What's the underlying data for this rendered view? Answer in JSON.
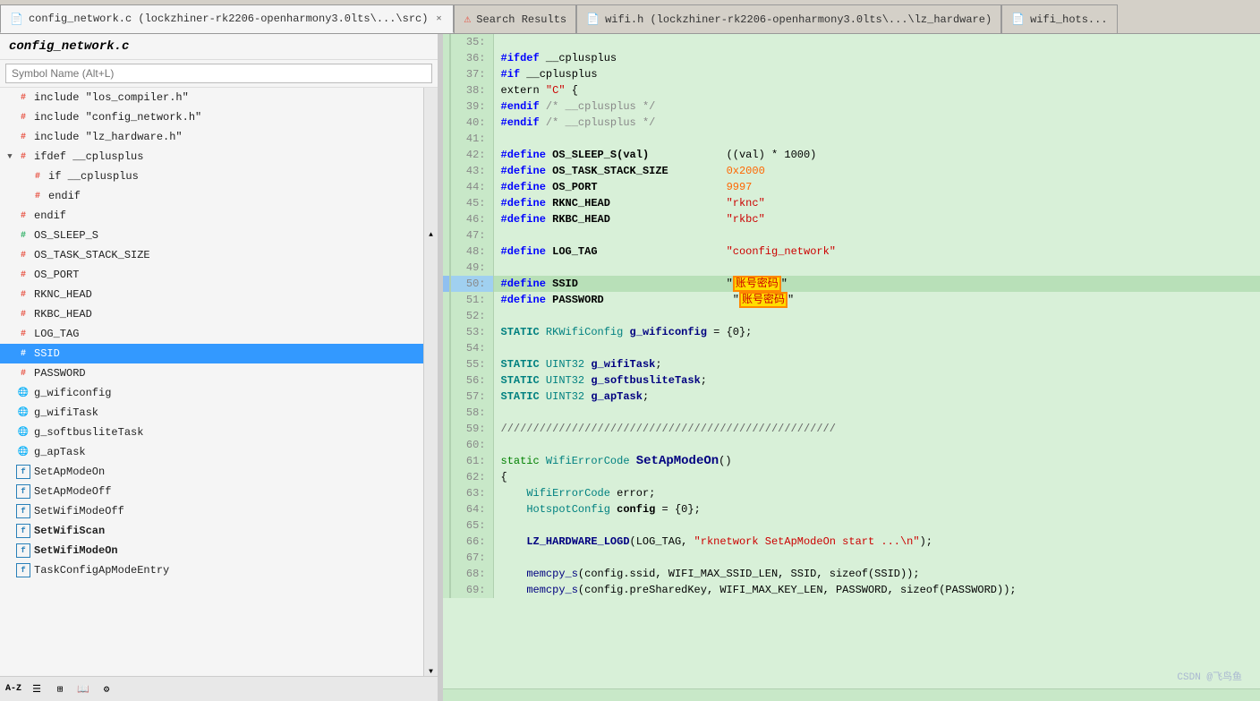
{
  "tabs": [
    {
      "id": "tab1",
      "label": "config_network.c (lockzhiner-rk2206-openharmony3.0lts\\...\\src)",
      "active": true,
      "closable": true,
      "icon": "file"
    },
    {
      "id": "tab2",
      "label": "Search Results",
      "active": false,
      "closable": false,
      "icon": "error"
    },
    {
      "id": "tab3",
      "label": "wifi.h (lockzhiner-rk2206-openharmony3.0lts\\...\\lz_hardware)",
      "active": false,
      "closable": false,
      "icon": "file"
    },
    {
      "id": "tab4",
      "label": "wifi_hots...",
      "active": false,
      "closable": false,
      "icon": "file"
    }
  ],
  "left_panel": {
    "title": "config_network.c",
    "search_placeholder": "Symbol Name (Alt+L)",
    "items": [
      {
        "id": "include1",
        "label": "include \"los_compiler.h\"",
        "icon": "hash-red",
        "level": 0,
        "expandable": false
      },
      {
        "id": "include2",
        "label": "include \"config_network.h\"",
        "icon": "hash-red",
        "level": 0,
        "expandable": false
      },
      {
        "id": "include3",
        "label": "include \"lz_hardware.h\"",
        "icon": "hash-red",
        "level": 0,
        "expandable": false
      },
      {
        "id": "ifdef1",
        "label": "ifdef __cplusplus",
        "icon": "hash-red",
        "level": 0,
        "expandable": true,
        "expanded": true
      },
      {
        "id": "if1",
        "label": "if __cplusplus",
        "icon": "hash-red",
        "level": 1,
        "expandable": false
      },
      {
        "id": "endif1",
        "label": "endif",
        "icon": "hash-red",
        "level": 1,
        "expandable": false
      },
      {
        "id": "endif2",
        "label": "endif",
        "icon": "hash-red",
        "level": 0,
        "expandable": false
      },
      {
        "id": "ossleep",
        "label": "OS_SLEEP_S",
        "icon": "hash-green",
        "level": 0,
        "expandable": false
      },
      {
        "id": "ostask",
        "label": "OS_TASK_STACK_SIZE",
        "icon": "hash-red",
        "level": 0,
        "expandable": false
      },
      {
        "id": "osport",
        "label": "OS_PORT",
        "icon": "hash-red",
        "level": 0,
        "expandable": false
      },
      {
        "id": "rknc",
        "label": "RKNC_HEAD",
        "icon": "hash-red",
        "level": 0,
        "expandable": false
      },
      {
        "id": "rkbc",
        "label": "RKBC_HEAD",
        "icon": "hash-red",
        "level": 0,
        "expandable": false
      },
      {
        "id": "logtag",
        "label": "LOG_TAG",
        "icon": "hash-red",
        "level": 0,
        "expandable": false
      },
      {
        "id": "ssid",
        "label": "SSID",
        "icon": "hash-red",
        "level": 0,
        "expandable": false,
        "selected": true
      },
      {
        "id": "password",
        "label": "PASSWORD",
        "icon": "hash-red",
        "level": 0,
        "expandable": false
      },
      {
        "id": "gwifi",
        "label": "g_wificonfig",
        "icon": "globe",
        "level": 0,
        "expandable": false
      },
      {
        "id": "gwifitask",
        "label": "g_wifiTask",
        "icon": "globe",
        "level": 0,
        "expandable": false
      },
      {
        "id": "gsoftbus",
        "label": "g_softbusliteTask",
        "icon": "globe",
        "level": 0,
        "expandable": false
      },
      {
        "id": "gaptask",
        "label": "g_apTask",
        "icon": "globe",
        "level": 0,
        "expandable": false
      },
      {
        "id": "setap",
        "label": "SetApModeOn",
        "icon": "func",
        "level": 0,
        "expandable": false
      },
      {
        "id": "setapoff",
        "label": "SetApModeOff",
        "icon": "func",
        "level": 0,
        "expandable": false
      },
      {
        "id": "setwifioff",
        "label": "SetWifiModeOff",
        "icon": "func",
        "level": 0,
        "expandable": false
      },
      {
        "id": "setwifiscan",
        "label": "SetWifiScan",
        "icon": "func",
        "level": 0,
        "expandable": false,
        "bold": true
      },
      {
        "id": "setwifion",
        "label": "SetWifiModeOn",
        "icon": "func",
        "level": 0,
        "expandable": false,
        "bold": true
      },
      {
        "id": "taskconfig",
        "label": "TaskConfigApModeEntry",
        "icon": "func",
        "level": 0,
        "expandable": false
      }
    ],
    "toolbar": [
      {
        "id": "az",
        "label": "A-Z",
        "title": "Sort alphabetically"
      },
      {
        "id": "list",
        "label": "≡",
        "title": "List view"
      },
      {
        "id": "grid",
        "label": "⊞",
        "title": "Grid view"
      },
      {
        "id": "book",
        "label": "📖",
        "title": "Reference"
      },
      {
        "id": "gear",
        "label": "⚙",
        "title": "Settings"
      }
    ]
  },
  "code": {
    "lines": [
      {
        "num": 35,
        "content": "",
        "indicator": false
      },
      {
        "num": 36,
        "content": "#ifdef __cplusplus",
        "indicator": false
      },
      {
        "num": 37,
        "content": "#if __cplusplus",
        "indicator": false
      },
      {
        "num": 38,
        "content": "extern \"C\" {",
        "indicator": false
      },
      {
        "num": 39,
        "content": "#endif /* __cplusplus */",
        "indicator": false
      },
      {
        "num": 40,
        "content": "#endif /* __cplusplus */",
        "indicator": false
      },
      {
        "num": 41,
        "content": "",
        "indicator": false
      },
      {
        "num": 42,
        "content": "#define OS_SLEEP_S(val)            ((val) * 1000)",
        "indicator": false
      },
      {
        "num": 43,
        "content": "#define OS_TASK_STACK_SIZE         0x2000",
        "indicator": false
      },
      {
        "num": 44,
        "content": "#define OS_PORT                    9997",
        "indicator": false
      },
      {
        "num": 45,
        "content": "#define RKNC_HEAD                  \"rknc\"",
        "indicator": false
      },
      {
        "num": 46,
        "content": "#define RKBC_HEAD                  \"rkbc\"",
        "indicator": false
      },
      {
        "num": 47,
        "content": "",
        "indicator": false
      },
      {
        "num": 48,
        "content": "#define LOG_TAG                    \"coonfig_network\"",
        "indicator": false
      },
      {
        "num": 49,
        "content": "",
        "indicator": false
      },
      {
        "num": 50,
        "content": "#define SSID                       \"账号密码\"",
        "indicator": true
      },
      {
        "num": 51,
        "content": "#define PASSWORD                    \"账号密码\"",
        "indicator": false
      },
      {
        "num": 52,
        "content": "",
        "indicator": false
      },
      {
        "num": 53,
        "content": "STATIC RKWifiConfig g_wificonfig = {0};",
        "indicator": false
      },
      {
        "num": 54,
        "content": "",
        "indicator": false
      },
      {
        "num": 55,
        "content": "STATIC UINT32 g_wifiTask;",
        "indicator": false
      },
      {
        "num": 56,
        "content": "STATIC UINT32 g_softbusliteTask;",
        "indicator": false
      },
      {
        "num": 57,
        "content": "STATIC UINT32 g_apTask;",
        "indicator": false
      },
      {
        "num": 58,
        "content": "",
        "indicator": false
      },
      {
        "num": 59,
        "content": "////////////////////////////////////////////////////",
        "indicator": false
      },
      {
        "num": 60,
        "content": "",
        "indicator": false
      },
      {
        "num": 61,
        "content": "static WifiErrorCode SetApModeOn()",
        "indicator": false
      },
      {
        "num": 62,
        "content": "{",
        "indicator": false
      },
      {
        "num": 63,
        "content": "    WifiErrorCode error;",
        "indicator": false
      },
      {
        "num": 64,
        "content": "    HotspotConfig config = {0};",
        "indicator": false
      },
      {
        "num": 65,
        "content": "",
        "indicator": false
      },
      {
        "num": 66,
        "content": "    LZ_HARDWARE_LOGD(LOG_TAG, \"rknetwork SetApModeOn start ...\\n\");",
        "indicator": false
      },
      {
        "num": 67,
        "content": "",
        "indicator": false
      },
      {
        "num": 68,
        "content": "    memcpy_s(config.ssid, WIFI_MAX_SSID_LEN, SSID, sizeof(SSID));",
        "indicator": false
      },
      {
        "num": 69,
        "content": "    memcpy_s(config.preSharedKey, WIFI_MAX_KEY_LEN, PASSWORD, sizeof(PASSWORD));",
        "indicator": false
      }
    ]
  },
  "watermark": "CSDN @飞鸟鱼"
}
